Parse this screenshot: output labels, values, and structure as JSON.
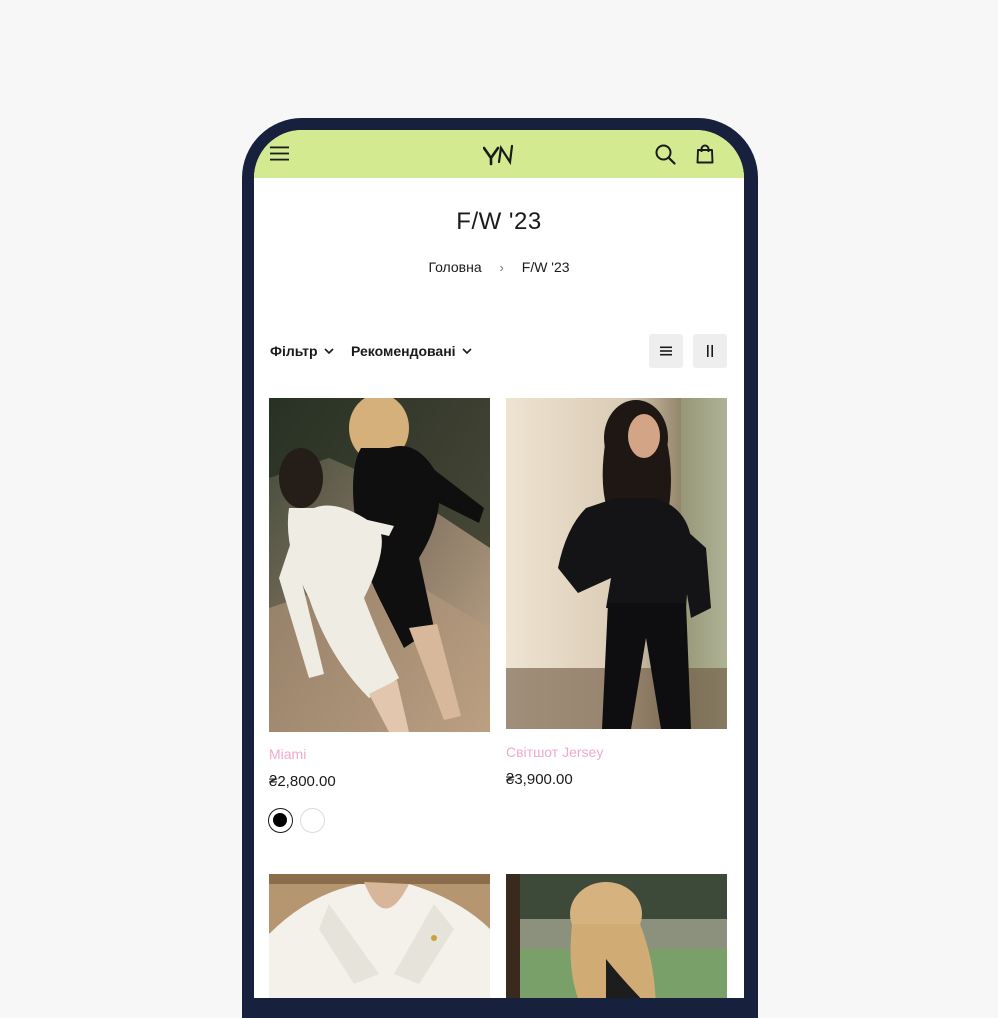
{
  "header": {
    "menu_icon": "hamburger-menu-icon",
    "logo_text": "YN",
    "search_icon": "search-icon",
    "bag_icon": "shopping-bag-icon",
    "accent_color": "#d4ea91"
  },
  "page": {
    "title": "F/W '23",
    "breadcrumb": {
      "home": "Головна",
      "separator": "›",
      "current": "F/W '23"
    }
  },
  "toolbar": {
    "filter_label": "Фільтр",
    "sort_label": "Рекомендовані",
    "view_list_icon": "list-view-icon",
    "view_grid_icon": "grid-view-icon"
  },
  "products": [
    {
      "name": "Miami",
      "price": "₴2,800.00",
      "image": "two-models-black-and-white-bodysuits",
      "swatches": [
        "#000000",
        "#ffffff"
      ]
    },
    {
      "name": "Світшот Jersey",
      "price": "₴3,900.00",
      "image": "model-black-sweatshirt-and-leggings"
    },
    {
      "name": "",
      "price": "",
      "image": "model-white-collared-top"
    },
    {
      "name": "",
      "price": "",
      "image": "blonde-model-outdoor-court"
    }
  ],
  "colors": {
    "frame": "#17213d",
    "product_name": "#f0a8cf"
  }
}
